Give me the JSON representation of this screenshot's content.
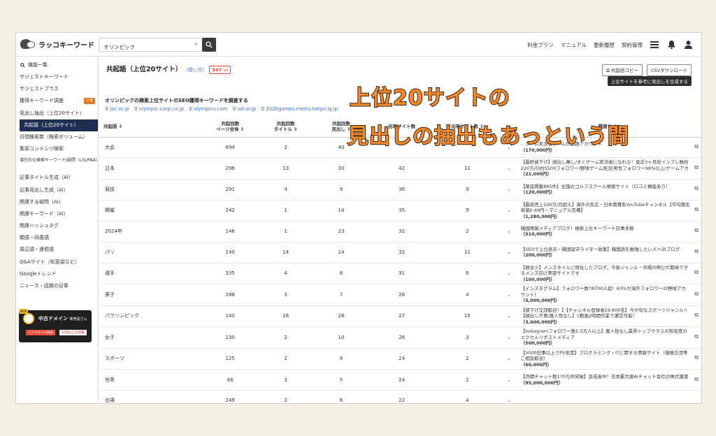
{
  "app": {
    "name": "ラッコキーワード"
  },
  "search": {
    "value": "オリンピック"
  },
  "topnav": {
    "items": [
      "料金プラン",
      "マニュアル",
      "更新履歴",
      "契約管理"
    ]
  },
  "sidebar": {
    "header": "機能一覧",
    "items": [
      {
        "label": "サジェストキーワード"
      },
      {
        "label": "サジェストプラス"
      },
      {
        "label": "獲得キーワード調査",
        "badge": "人気"
      },
      {
        "label": "見出し抽出（上位20サイト）"
      },
      {
        "label": "共起語（上位20サイト）",
        "active": true
      },
      {
        "label": "月間検索数（検索ボリューム）"
      },
      {
        "label": "集客コンテンツ検索"
      },
      {
        "label": "潜在的な検索キーワード/疑問（LSI/PAA）",
        "small": true
      },
      {
        "label": "記事タイトル生成（AI）"
      },
      {
        "label": "記事見出し生成（AI）"
      },
      {
        "label": "関連する疑問（AI）"
      },
      {
        "label": "関連キーワード（AI）"
      },
      {
        "label": "関連ハッシュタグ"
      },
      {
        "label": "類語・同義語"
      },
      {
        "label": "周辺語・連想語"
      },
      {
        "label": "Q&Aサイト（知恵袋など）"
      },
      {
        "label": "Googleトレンド"
      },
      {
        "label": "ニュース・話題の記事"
      }
    ],
    "banner": {
      "tag": "NEW",
      "title": "中古ドメイン",
      "subtitle": "販売屋さん",
      "chip1": "リアルタイム納品",
      "chip2": "10年以上の実績"
    }
  },
  "main": {
    "title": "共起語（上位20サイト）",
    "how": "（使い方）",
    "count": "537",
    "count_unit": "sol",
    "copy_btn": "共起語コピー",
    "csv_btn": "CSVダウンロード",
    "gen_btn": "上位サイトを参考に見出しを生成する",
    "description": "オリンピックの検索上位サイトのSEO獲得キーワードを調査する",
    "links": [
      "joc.or.jp",
      "olympic-corp.co.jp",
      "olympics.com",
      "ssf.or.jp",
      "2020games.metro.tokyo.lg.jp"
    ]
  },
  "table": {
    "headers": [
      "共起語 ⇕",
      "共起回数\nページ全体 ⇕",
      "共起回数\nタイトル ⇕",
      "共起回数\n見出し ⇕",
      "出現サイト数",
      "出現サイト数 ⇕",
      "",
      "関連サイト"
    ],
    "rows": [
      {
        "kw": "大会",
        "c1": "694",
        "c2": "2",
        "c3": "40",
        "c4": "",
        "c5": "",
        "site": "…ゲーム実況者ゲーム外国籍アカウント",
        "price": "（170,000円）"
      },
      {
        "kw": "日本",
        "c1": "296",
        "c2": "13",
        "c3": "30",
        "c4": "42",
        "c5": "11",
        "site": "【最終値下げ】顔出し無し/すぐゲーム実況者になれる！直近3ヶ月総インプレ数約220万/計約5500フォロワー/野球ゲーム実況/男性フォロワー98%以上/ゲームアカウント付き/",
        "price": "（21,000円）"
      },
      {
        "kw": "競技",
        "c1": "291",
        "c2": "4",
        "c3": "9",
        "c4": "36",
        "c5": "9",
        "site": "【施設掲載865件】全国のゴルフスクール検索サイト（口コミ機能あり）",
        "price": "（120,000円）"
      },
      {
        "kw": "開催",
        "c1": "242",
        "c2": "1",
        "c3": "14",
        "c4": "35",
        "c5": "9",
        "site": "【最高売上100万/月超え】海外の反応・日本賞賛系YouTubeチャンネル【平均再生単価0.49円・マニュアル完備】",
        "price": "（1,280,000円）"
      },
      {
        "kw": "2024年",
        "c1": "146",
        "c2": "1",
        "c3": "23",
        "c4": "32",
        "c5": "2",
        "site": "韓国情報メディアブログ！検索上位キーワード記事多数",
        "price": "（510,000円）"
      },
      {
        "kw": "パリ",
        "c1": "140",
        "c2": "14",
        "c3": "14",
        "c4": "32",
        "c5": "11",
        "site": "【SEOで上位表示・韓国留学ライター執筆】韓国語を勉強したい人へのブログ",
        "price": "（200,000円）"
      },
      {
        "kw": "選手",
        "c1": "335",
        "c2": "4",
        "c3": "8",
        "c4": "31",
        "c5": "6",
        "site": "【競合少】メンズネイルに特化したブログ。今後ジャンル・市場の伸びが期待できるメンズ向け美容サイトです",
        "price": "（100,000円）"
      },
      {
        "kw": "男子",
        "c1": "288",
        "c2": "3",
        "c3": "7",
        "c4": "28",
        "c5": "4",
        "site": "【インスタグラム】フォロワー数78700人超！63%が海外フォロワーの野球アカウント！",
        "price": "（5,000,000円）"
      },
      {
        "kw": "パラリンピック",
        "c1": "140",
        "c2": "16",
        "c3": "28",
        "c4": "27",
        "c5": "15",
        "site": "【値下げ交渉歓迎！】【チャンネル登録者19,800名】今が旬なスポーツジャンル!!【顔出し不要/属人性なし】1動画2時間作業で運営可能！",
        "price": "（3,600,000円）"
      },
      {
        "kw": "女子",
        "c1": "230",
        "c2": "2",
        "c3": "10",
        "c4": "26",
        "c5": "3",
        "site": "【Instagramフォロワー数5.5万人以上】属人性なし業界トップクラスの知名度のエクセルリポストメディア",
        "price": "（500,000円）"
      },
      {
        "kw": "スポーツ",
        "c1": "125",
        "c2": "2",
        "c3": "8",
        "c4": "24",
        "c5": "2",
        "site": "【5000記事以上でPV安定】プログラミング・ITに関する情報サイト（価格交渉等ご相談歓迎）",
        "price": "（60,000円）"
      },
      {
        "kw": "世界",
        "c1": "66",
        "c2": "3",
        "c3": "5",
        "c4": "24",
        "c5": "2",
        "site": "【月間チャット数170万件突破】急成長中！日本最大級AIチャット会社の株式譲渡",
        "price": "（95,000,000円）"
      },
      {
        "kw": "出場",
        "c1": "249",
        "c2": "2",
        "c3": "6",
        "c4": "22",
        "c5": "4",
        "site": "",
        "price": ""
      }
    ]
  },
  "overlay": {
    "line1": "上位20サイトの",
    "line2": "見出しの抽出もあっという間"
  },
  "colors": {
    "accent": "#1e2e52",
    "overlay": "#f5882a",
    "link": "#3a6fc4",
    "badge": "#e8761e"
  }
}
